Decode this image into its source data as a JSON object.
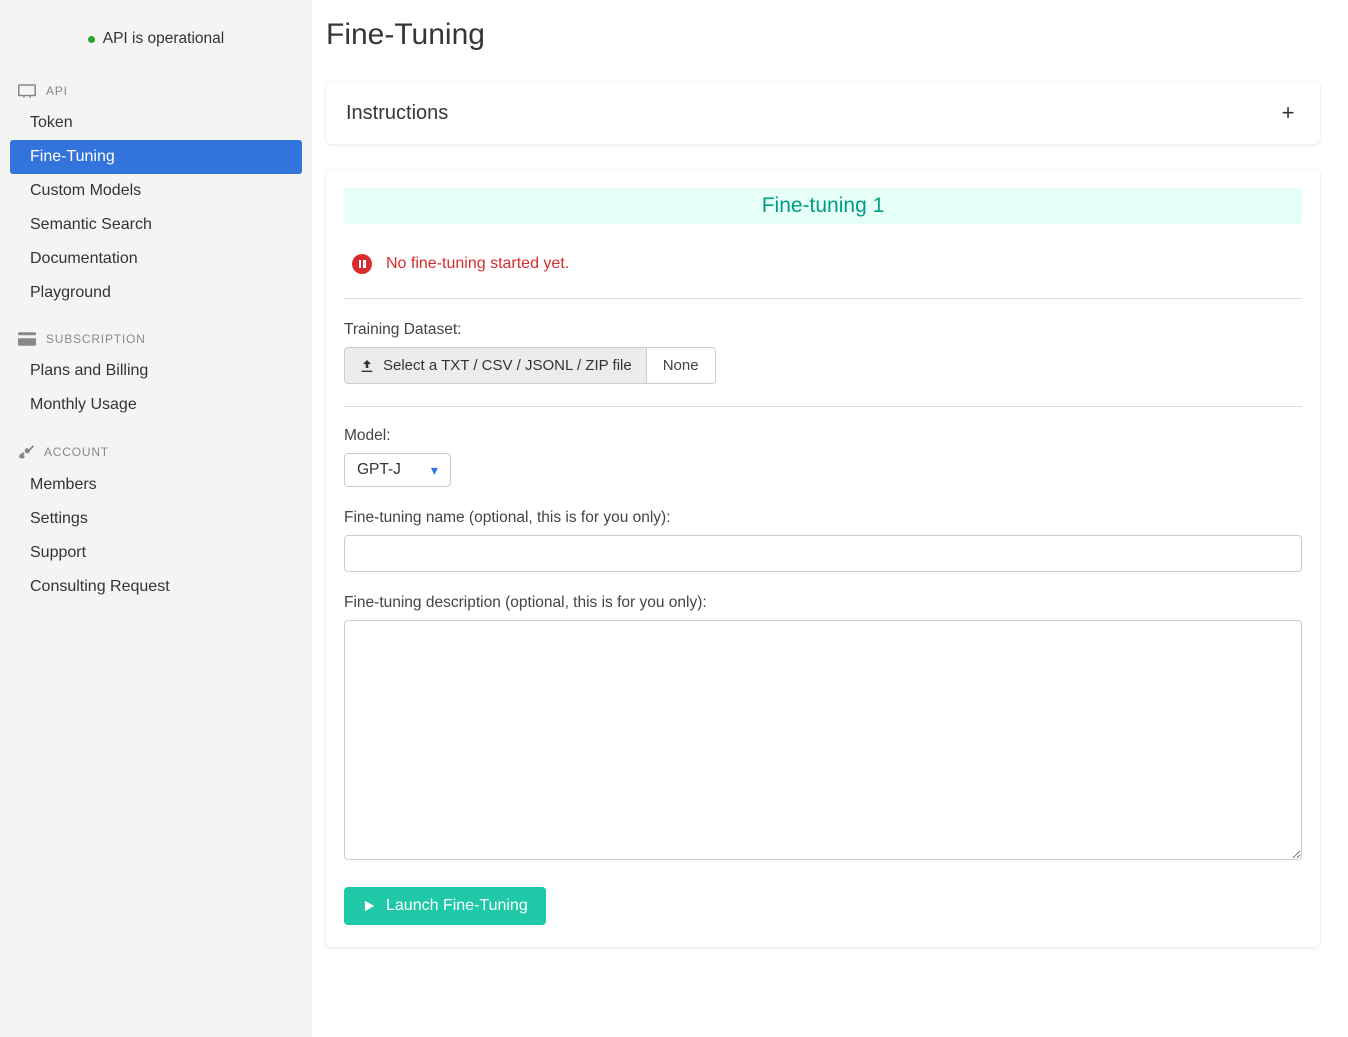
{
  "status": {
    "text": "API is operational"
  },
  "sections": {
    "api": {
      "label": "API",
      "items": [
        "Token",
        "Fine-Tuning",
        "Custom Models",
        "Semantic Search",
        "Documentation",
        "Playground"
      ],
      "active_index": 1
    },
    "subscription": {
      "label": "SUBSCRIPTION",
      "items": [
        "Plans and Billing",
        "Monthly Usage"
      ]
    },
    "account": {
      "label": "ACCOUNT",
      "items": [
        "Members",
        "Settings",
        "Support",
        "Consulting Request"
      ]
    }
  },
  "page": {
    "title": "Fine-Tuning"
  },
  "instructions": {
    "title": "Instructions"
  },
  "finetune": {
    "banner": "Fine-tuning 1",
    "alert": "No fine-tuning started yet.",
    "training_label": "Training Dataset:",
    "upload_button": "Select a TXT / CSV / JSONL / ZIP file",
    "upload_value": "None",
    "model_label": "Model:",
    "model_value": "GPT-J",
    "name_label": "Fine-tuning name (optional, this is for you only):",
    "name_value": "",
    "desc_label": "Fine-tuning description (optional, this is for you only):",
    "desc_value": "",
    "launch_button": "Launch Fine-Tuning"
  }
}
